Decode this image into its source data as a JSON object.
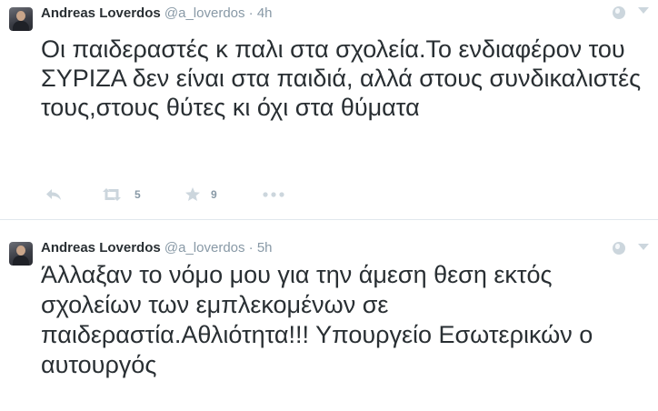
{
  "tweets": [
    {
      "fullname": "Andreas Loverdos",
      "username": "@a_loverdos",
      "separator": "·",
      "time": "4h",
      "text": "Οι παιδεραστές κ παλι στα σχολεία.Το ενδιαφέρον του ΣΥΡΙΖΑ δεν είναι στα παιδιά, αλλά στους συνδικαλιστές τους,στους θύτες κι όχι στα θύματα",
      "retweets": "5",
      "favorites": "9"
    },
    {
      "fullname": "Andreas Loverdos",
      "username": "@a_loverdos",
      "separator": "·",
      "time": "5h",
      "text": "Άλλαξαν το νόμο μου για την άμεση θεση εκτός σχολείων των εμπλεκομένων σε παιδεραστία.Αθλιότητα!!! Υπουργείο Εσωτερικών ο αυτουργός"
    }
  ],
  "icons": {
    "reply": "reply-icon",
    "retweet": "retweet-icon",
    "favorite": "star-icon",
    "more": "more-icon",
    "privacy": "globe-icon",
    "menu": "chevron-down-icon"
  },
  "colors": {
    "text": "#292f33",
    "muted": "#8899a6",
    "icon": "#ccd6dd",
    "divider": "#e1e8ed"
  }
}
